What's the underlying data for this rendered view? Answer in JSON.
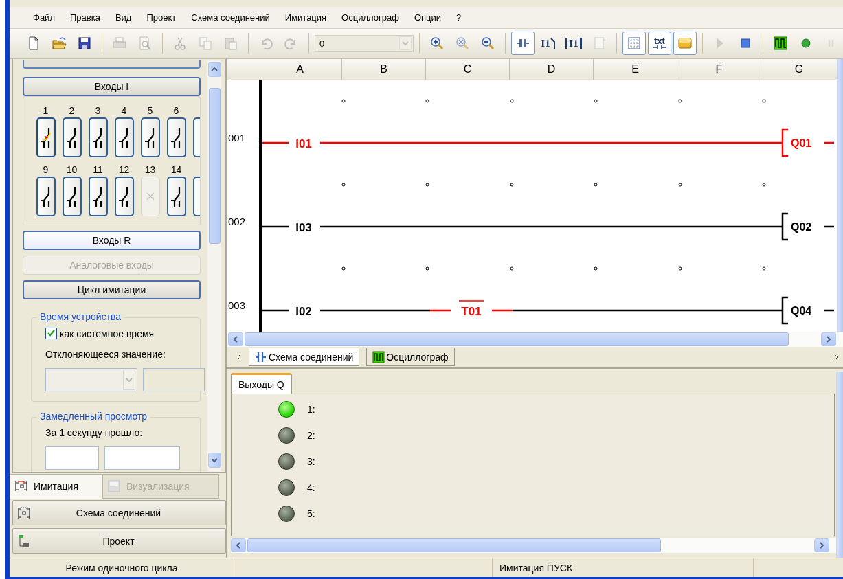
{
  "menu": [
    "Файл",
    "Правка",
    "Вид",
    "Проект",
    "Схема соединений",
    "Имитация",
    "Осциллограф",
    "Опции",
    "?"
  ],
  "toolbar": [
    [
      {
        "kind": "new",
        "disabled": false,
        "pressed": false
      },
      {
        "kind": "open",
        "disabled": false,
        "pressed": false
      },
      {
        "kind": "save",
        "disabled": false,
        "pressed": false
      }
    ],
    [
      {
        "kind": "print",
        "disabled": true,
        "pressed": false
      },
      {
        "kind": "preview",
        "disabled": true,
        "pressed": false
      }
    ],
    [
      {
        "kind": "cut",
        "disabled": true,
        "pressed": false
      },
      {
        "kind": "copy",
        "disabled": true,
        "pressed": false
      },
      {
        "kind": "paste",
        "disabled": true,
        "pressed": false
      }
    ],
    [
      {
        "kind": "undo",
        "disabled": true,
        "pressed": false
      },
      {
        "kind": "redo",
        "disabled": true,
        "pressed": false
      }
    ],
    [
      {
        "kind": "combo",
        "value": "0",
        "disabled": true
      }
    ],
    [
      {
        "kind": "zoom-in",
        "disabled": false,
        "pressed": false
      },
      {
        "kind": "zoom-reset",
        "disabled": true,
        "pressed": false
      },
      {
        "kind": "zoom-out",
        "disabled": false,
        "pressed": false
      }
    ],
    [
      {
        "kind": "contact",
        "disabled": false,
        "pressed": true
      },
      {
        "kind": "contact-nc",
        "label": "I1",
        "disabled": false,
        "pressed": false
      },
      {
        "kind": "contact-bracket",
        "label": "I1",
        "disabled": false,
        "pressed": false
      },
      {
        "kind": "block",
        "disabled": true,
        "pressed": false
      }
    ],
    [
      {
        "kind": "grid",
        "disabled": false,
        "pressed": true
      },
      {
        "kind": "text",
        "label": "txt",
        "disabled": false,
        "pressed": true
      },
      {
        "kind": "color",
        "disabled": false,
        "pressed": true
      }
    ],
    [
      {
        "kind": "play",
        "disabled": true,
        "pressed": false
      },
      {
        "kind": "stop",
        "disabled": false,
        "pressed": false
      }
    ],
    [
      {
        "kind": "chart",
        "disabled": false,
        "pressed": false
      },
      {
        "kind": "record",
        "disabled": false,
        "pressed": false
      },
      {
        "kind": "pause",
        "disabled": true,
        "pressed": false
      }
    ]
  ],
  "inputs_i": {
    "label": "Входы I",
    "rows": [
      [
        {
          "number": "1",
          "kind": "switch",
          "active": true
        },
        {
          "number": "2",
          "kind": "switch",
          "active": false
        },
        {
          "number": "3",
          "kind": "switch",
          "active": false
        },
        {
          "number": "4",
          "kind": "switch",
          "active": false
        },
        {
          "number": "5",
          "kind": "switch",
          "active": false
        },
        {
          "number": "6",
          "kind": "switch",
          "active": false
        },
        {
          "kind": "switch",
          "active": false
        }
      ],
      [
        {
          "number": "9",
          "kind": "switch",
          "active": false
        },
        {
          "number": "10",
          "kind": "switch",
          "active": false
        },
        {
          "number": "11",
          "kind": "switch",
          "active": false
        },
        {
          "number": "12",
          "kind": "switch",
          "active": false
        },
        {
          "number": "13",
          "kind": "unused"
        },
        {
          "number": "14",
          "kind": "switch",
          "active": false
        },
        {
          "kind": "switch",
          "active": false
        }
      ]
    ]
  },
  "sections": [
    {
      "label": "Входы R",
      "highlighted": true,
      "disabled": false
    },
    {
      "label": "Аналоговые входы",
      "highlighted": false,
      "disabled": true
    },
    {
      "label": "Цикл имитации",
      "highlighted": false,
      "disabled": false
    }
  ],
  "device_time": {
    "legend": "Время устройства",
    "checkbox": {
      "label": "как системное время",
      "checked": true
    },
    "deviation_label": "Отклоняющееся значение:"
  },
  "slow_view": {
    "legend": "Замедленный просмотр",
    "label": "За 1 секунду прошло:"
  },
  "left_tabs": [
    {
      "label": "Имитация",
      "selected": true,
      "disabled": false
    },
    {
      "label": "Визуализация",
      "selected": false,
      "disabled": true
    }
  ],
  "nav_buttons": [
    {
      "label": "Схема соединений",
      "kind": "diagram"
    },
    {
      "label": "Проект",
      "kind": "project"
    }
  ],
  "ladder": {
    "columns": [
      "A",
      "B",
      "C",
      "D",
      "E",
      "F",
      "G"
    ],
    "rungs": [
      {
        "number": "001",
        "on": true,
        "contact": {
          "label": "I01",
          "on": true
        },
        "coil": {
          "label": "Q01",
          "on": true
        }
      },
      {
        "number": "002",
        "on": false,
        "contact": {
          "label": "I03",
          "on": false
        },
        "coil": {
          "label": "Q02",
          "on": false
        }
      },
      {
        "number": "003",
        "on": false,
        "contact": {
          "label": "I02",
          "on": false
        },
        "middle": {
          "label": "T01",
          "on": true,
          "negated": true
        },
        "coil": {
          "label": "Q04",
          "on": false
        }
      }
    ]
  },
  "sheet_tabs": [
    {
      "label": "Схема соединений",
      "kind": "diagram",
      "selected": true
    },
    {
      "label": "Осциллограф",
      "kind": "chart",
      "selected": false
    }
  ],
  "outputs": {
    "tab": "Выходы Q",
    "items": [
      {
        "label": "1:",
        "on": true
      },
      {
        "label": "2:",
        "on": false
      },
      {
        "label": "3:",
        "on": false
      },
      {
        "label": "4:",
        "on": false
      },
      {
        "label": "5:",
        "on": false
      }
    ]
  },
  "status_bar": [
    "Режим одиночного цикла",
    "Имитация ПУСК"
  ]
}
